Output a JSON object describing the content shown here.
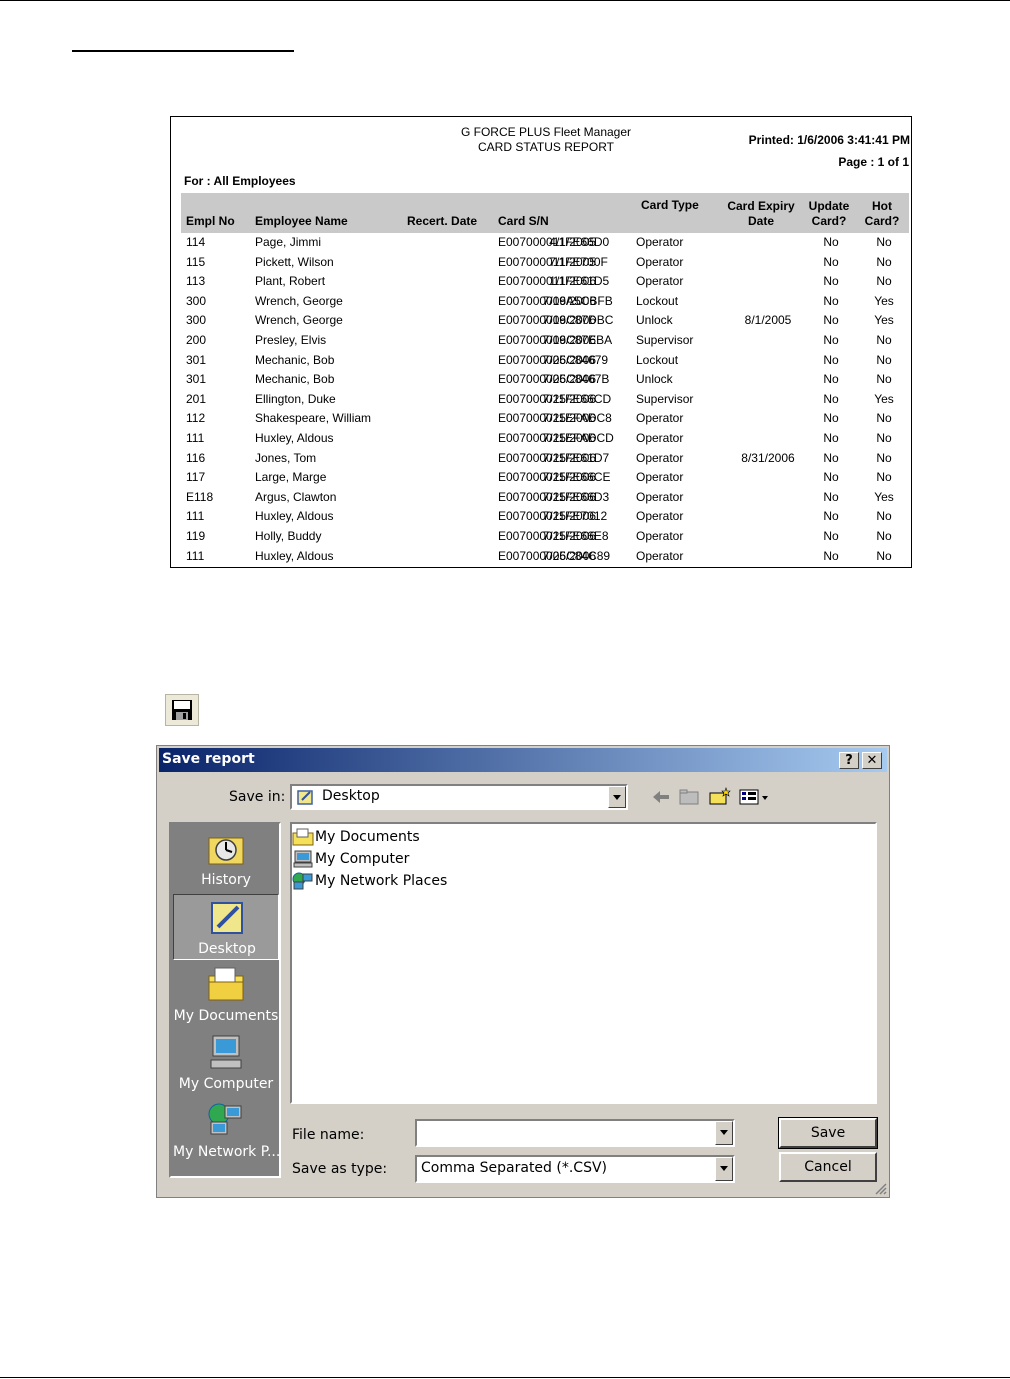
{
  "report": {
    "title_line1": "G FORCE PLUS Fleet Manager",
    "title_line2": "CARD STATUS REPORT",
    "printed": "Printed: 1/6/2006 3:41:41 PM",
    "page": "Page : 1 of 1",
    "for": "For : All Employees",
    "columns": {
      "empl_no": "Empl No",
      "employee_name": "Employee Name",
      "recert_date": "Recert. Date",
      "card_sn": "Card S/N",
      "card_type": "Card Type",
      "card_expiry_line1": "Card Expiry",
      "card_expiry_line2": "Date",
      "update_line1": "Update",
      "update_line2": "Card?",
      "hot_line1": "Hot",
      "hot_line2": "Card?"
    },
    "rows": [
      {
        "empl": "114",
        "name": "Page, Jimmi",
        "recert": "4/1/2005",
        "sn": "E007000011FE66D0",
        "type": "Operator",
        "expiry": "",
        "update": "No",
        "hot": "No"
      },
      {
        "empl": "115",
        "name": "Pickett, Wilson",
        "recert": "7/1/2005",
        "sn": "E007000011FE700F",
        "type": "Operator",
        "expiry": "",
        "update": "No",
        "hot": "No"
      },
      {
        "empl": "113",
        "name": "Plant, Robert",
        "recert": "1/1/2006",
        "sn": "E007000011FE61D5",
        "type": "Operator",
        "expiry": "",
        "update": "No",
        "hot": "No"
      },
      {
        "empl": "300",
        "name": "Wrench, George",
        "recert": "7/19/2006",
        "sn": "E007000006A5CBFB",
        "type": "Lockout",
        "expiry": "",
        "update": "No",
        "hot": "Yes"
      },
      {
        "empl": "300",
        "name": "Wrench, George",
        "recert": "7/19/2006",
        "sn": "E007000006C87DBC",
        "type": "Unlock",
        "expiry": "8/1/2005",
        "update": "No",
        "hot": "Yes"
      },
      {
        "empl": "200",
        "name": "Presley, Elvis",
        "recert": "7/19/2006",
        "sn": "E007000006C87EBA",
        "type": "Supervisor",
        "expiry": "",
        "update": "No",
        "hot": "No"
      },
      {
        "empl": "301",
        "name": "Mechanic, Bob",
        "recert": "7/25/2006",
        "sn": "E007000006C84679",
        "type": "Lockout",
        "expiry": "",
        "update": "No",
        "hot": "No"
      },
      {
        "empl": "301",
        "name": "Mechanic, Bob",
        "recert": "7/25/2006",
        "sn": "E007000006C8467B",
        "type": "Unlock",
        "expiry": "",
        "update": "No",
        "hot": "No"
      },
      {
        "empl": "201",
        "name": "Ellington, Duke",
        "recert": "7/25/2006",
        "sn": "E007000011FE66CD",
        "type": "Supervisor",
        "expiry": "",
        "update": "No",
        "hot": "Yes"
      },
      {
        "empl": "112",
        "name": "Shakespeare, William",
        "recert": "7/25/2006",
        "sn": "E007000011EFADC8",
        "type": "Operator",
        "expiry": "",
        "update": "No",
        "hot": "No"
      },
      {
        "empl": "111",
        "name": "Huxley, Aldous",
        "recert": "7/25/2006",
        "sn": "E007000011EFADCD",
        "type": "Operator",
        "expiry": "",
        "update": "No",
        "hot": "No"
      },
      {
        "empl": "116",
        "name": "Jones, Tom",
        "recert": "7/25/2006",
        "sn": "E007000011FE61D7",
        "type": "Operator",
        "expiry": "8/31/2006",
        "update": "No",
        "hot": "No"
      },
      {
        "empl": "117",
        "name": "Large, Marge",
        "recert": "7/25/2006",
        "sn": "E007000011FE66CE",
        "type": "Operator",
        "expiry": "",
        "update": "No",
        "hot": "No"
      },
      {
        "empl": "E118",
        "name": "Argus, Clawton",
        "recert": "7/25/2006",
        "sn": "E007000011FE66D3",
        "type": "Operator",
        "expiry": "",
        "update": "No",
        "hot": "Yes"
      },
      {
        "empl": "111",
        "name": "Huxley, Aldous",
        "recert": "7/25/2006",
        "sn": "E007000011FE7012",
        "type": "Operator",
        "expiry": "",
        "update": "No",
        "hot": "No"
      },
      {
        "empl": "119",
        "name": "Holly, Buddy",
        "recert": "7/25/2006",
        "sn": "E007000011FE66E8",
        "type": "Operator",
        "expiry": "",
        "update": "No",
        "hot": "No"
      },
      {
        "empl": "111",
        "name": "Huxley, Aldous",
        "recert": "7/25/2006",
        "sn": "E007000006C84C89",
        "type": "Operator",
        "expiry": "",
        "update": "No",
        "hot": "No"
      }
    ]
  },
  "toolbar": {
    "save_icon": "floppy-disk-icon"
  },
  "dialog": {
    "title": "Save report",
    "help_label": "?",
    "close_label": "✕",
    "save_in_label": "Save in:",
    "save_in_value": "Desktop",
    "places": [
      {
        "label": "History",
        "icon": "history-icon"
      },
      {
        "label": "Desktop",
        "icon": "desktop-icon"
      },
      {
        "label": "My Documents",
        "icon": "my-documents-icon"
      },
      {
        "label": "My Computer",
        "icon": "my-computer-icon"
      },
      {
        "label": "My Network P...",
        "icon": "my-network-places-icon"
      }
    ],
    "files": [
      {
        "label": "My Documents",
        "icon": "my-documents-icon"
      },
      {
        "label": "My Computer",
        "icon": "my-computer-icon"
      },
      {
        "label": "My Network Places",
        "icon": "my-network-places-icon"
      }
    ],
    "file_name_label": "File name:",
    "file_name_value": "",
    "save_as_type_label": "Save as type:",
    "save_as_type_value": "Comma Separated (*.CSV)",
    "save_button": "Save",
    "cancel_button": "Cancel",
    "colors": {
      "titlebar_start": "#0a246a",
      "titlebar_end": "#a6caf0",
      "face": "#d4d0c8"
    }
  }
}
